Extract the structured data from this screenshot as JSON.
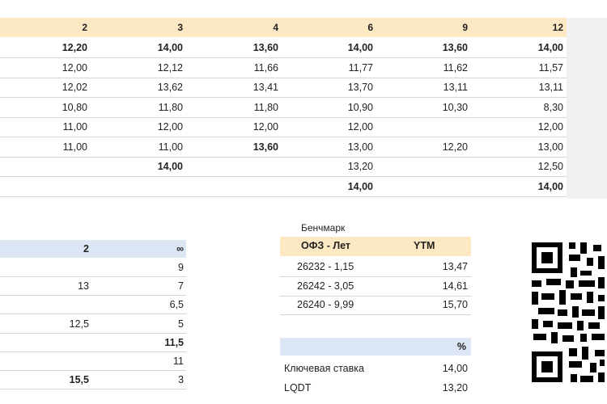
{
  "top_table": {
    "headers": [
      "2",
      "3",
      "4",
      "6",
      "9",
      "12"
    ],
    "rows": [
      {
        "cells": [
          "12,20",
          "14,00",
          "13,60",
          "14,00",
          "13,60",
          "14,00"
        ],
        "bold": [
          true,
          true,
          true,
          true,
          true,
          true
        ]
      },
      {
        "cells": [
          "12,00",
          "12,12",
          "11,66",
          "11,77",
          "11,62",
          "11,57"
        ],
        "bold": [
          false,
          false,
          false,
          false,
          false,
          false
        ]
      },
      {
        "cells": [
          "12,02",
          "13,62",
          "13,41",
          "13,70",
          "13,11",
          "13,11"
        ],
        "bold": [
          false,
          false,
          false,
          false,
          false,
          false
        ]
      },
      {
        "cells": [
          "10,80",
          "11,80",
          "11,80",
          "10,90",
          "10,30",
          "8,30"
        ],
        "bold": [
          false,
          false,
          false,
          false,
          false,
          false
        ]
      },
      {
        "cells": [
          "11,00",
          "12,00",
          "12,00",
          "12,00",
          "",
          "12,00"
        ],
        "bold": [
          false,
          false,
          false,
          false,
          false,
          false
        ]
      },
      {
        "cells": [
          "11,00",
          "11,00",
          "13,60",
          "13,00",
          "12,20",
          "13,00"
        ],
        "bold": [
          false,
          false,
          true,
          false,
          false,
          false
        ]
      },
      {
        "cells": [
          "",
          "14,00",
          "",
          "13,20",
          "",
          "12,50"
        ],
        "bold": [
          false,
          true,
          false,
          false,
          false,
          false
        ]
      },
      {
        "cells": [
          "",
          "",
          "",
          "14,00",
          "",
          "14,00"
        ],
        "bold": [
          false,
          false,
          false,
          true,
          false,
          true
        ]
      }
    ]
  },
  "bottom_left_table": {
    "headers": [
      "2",
      "∞"
    ],
    "rows": [
      {
        "cells": [
          "",
          "9"
        ],
        "bold": [
          false,
          false
        ]
      },
      {
        "cells": [
          "13",
          "7"
        ],
        "bold": [
          false,
          false
        ]
      },
      {
        "cells": [
          "",
          "6,5"
        ],
        "bold": [
          false,
          false
        ]
      },
      {
        "cells": [
          "12,5",
          "5"
        ],
        "bold": [
          false,
          false
        ]
      },
      {
        "cells": [
          "",
          "11,5"
        ],
        "bold": [
          false,
          true
        ]
      },
      {
        "cells": [
          "",
          "11"
        ],
        "bold": [
          false,
          false
        ]
      },
      {
        "cells": [
          "15,5",
          "3"
        ],
        "bold": [
          true,
          false
        ]
      }
    ]
  },
  "benchmark": {
    "title": "Бенчмарк",
    "headers": [
      "ОФЗ - Лет",
      "YTM"
    ],
    "rows": [
      {
        "bond": "26232 - 1,15",
        "ytm": "13,47"
      },
      {
        "bond": "26242 - 3,05",
        "ytm": "14,61"
      },
      {
        "bond": "26240 - 9,99",
        "ytm": "15,70"
      }
    ]
  },
  "rates": {
    "header": "%",
    "rows": [
      {
        "label": "Ключевая ставка",
        "value": "14,00"
      },
      {
        "label": "LQDT",
        "value": "13,20"
      }
    ]
  },
  "colors": {
    "header_orange": "#fce8c2",
    "header_blue": "#dce6f4"
  },
  "qr_icon": "qr-code-icon"
}
